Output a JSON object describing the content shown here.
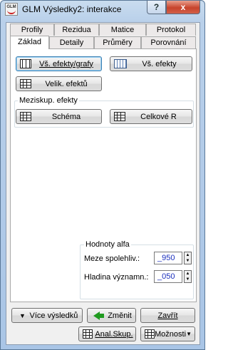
{
  "window": {
    "title": "GLM Výsledky2: interakce",
    "icon_text": "GLM",
    "help_label": "?",
    "close_label": "x"
  },
  "tabs": {
    "row_back": [
      "Profily",
      "Rezidua",
      "Matice",
      "Protokol"
    ],
    "row_front": [
      "Základ",
      "Detaily",
      "Průměry",
      "Porovnání"
    ],
    "active": "Základ"
  },
  "panel": {
    "btn_effects_graphs": "Vš. efekty/grafy",
    "btn_effects": "Vš. efekty",
    "btn_effect_sizes": "Velik. efektů",
    "between_group_title": "Meziskup. efekty",
    "btn_schema": "Schéma",
    "btn_overall_r": "Celkové R",
    "alpha_title": "Hodnoty alfa",
    "conf_label": "Meze spolehliv.:",
    "conf_value": "_950",
    "sig_label": "Hladina významn.:",
    "sig_value": "_050"
  },
  "footer": {
    "more_results": "Více výsledků",
    "change": "Změnit",
    "close": "Zavřít",
    "anal_skup": "Anal.Skup.",
    "options": "Možnosti"
  },
  "colors": {
    "input_text": "#1a2ebd",
    "close_red": "#c7442c",
    "arrow_green": "#1f9a1f"
  }
}
